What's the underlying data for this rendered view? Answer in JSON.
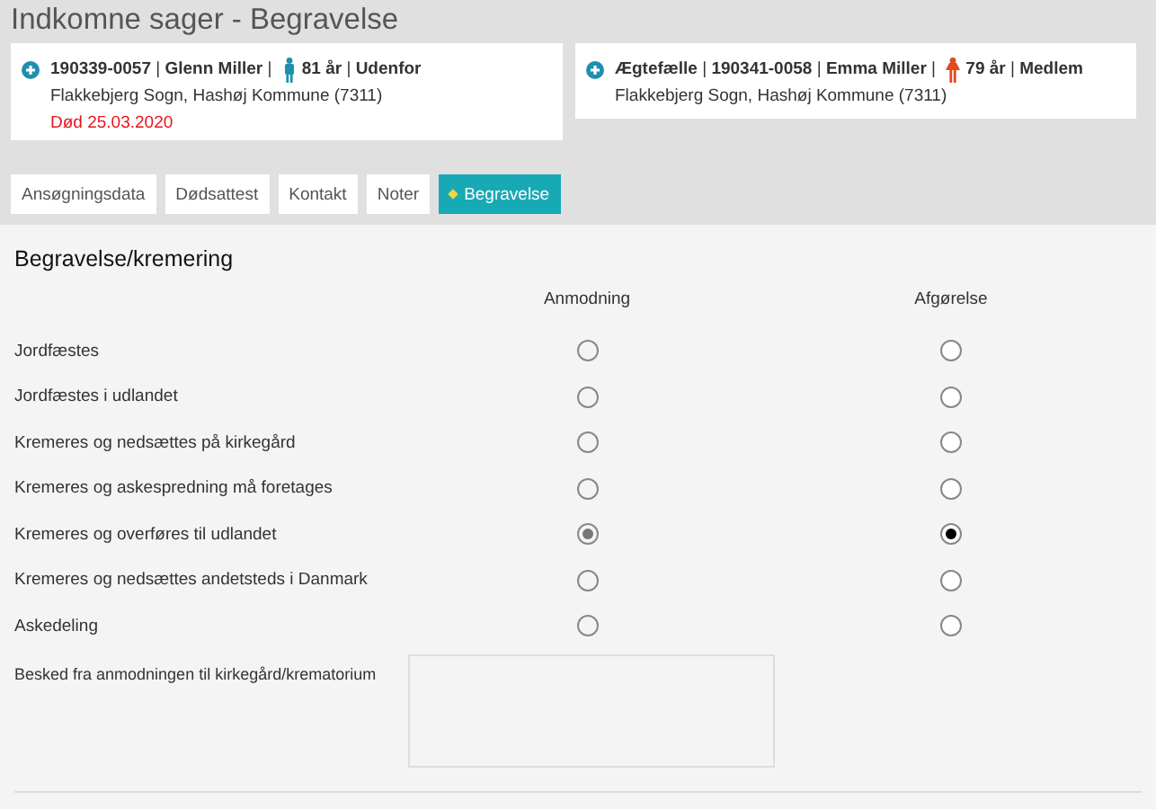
{
  "page_title": "Indkomne sager - Begravelse",
  "persons": [
    {
      "lead": "**190339-0057** | **Glenn Miller** | ",
      "kind": "male",
      "tail": "**81 år** | **Udenfor**",
      "address": "Flakkebjerg Sogn, Hashøj Kommune (7311)",
      "death": "Død 25.03.2020"
    },
    {
      "lead": "**Ægtefælle** | **190341-0058** | **Emma Miller** | ",
      "kind": "female",
      "tail": "**79 år** | **Medlem**",
      "address": "Flakkebjerg Sogn, Hashøj Kommune (7311)"
    }
  ],
  "tabs": [
    {
      "label": "Ansøgningsdata",
      "selected": false
    },
    {
      "label": "Dødsattest",
      "selected": false
    },
    {
      "label": "Kontakt",
      "selected": false
    },
    {
      "label": "Noter",
      "selected": false
    },
    {
      "label": "Begravelse",
      "selected": true
    }
  ],
  "section": {
    "title": "Begravelse/kremering",
    "columns": [
      {
        "label": "Anmodning",
        "disabled": true
      },
      {
        "label": "Afgørelse",
        "disabled": false
      }
    ],
    "rows": [
      {
        "label": "Jordfæstes",
        "choices": [
          {
            "selected": false
          },
          {
            "selected": false
          }
        ]
      },
      {
        "label": "Jordfæstes i udlandet",
        "choices": [
          {
            "selected": false
          },
          {
            "selected": false
          }
        ]
      },
      {
        "label": "Kremeres og nedsættes på kirkegård",
        "choices": [
          {
            "selected": false
          },
          {
            "selected": false
          }
        ]
      },
      {
        "label": "Kremeres og askespredning må foretages",
        "choices": [
          {
            "selected": false
          },
          {
            "selected": false
          }
        ]
      },
      {
        "label": "Kremeres og overføres til udlandet",
        "choices": [
          {
            "selected": true
          },
          {
            "selected": true
          }
        ]
      },
      {
        "label": "Kremeres og nedsættes andetsteds i Danmark",
        "choices": [
          {
            "selected": false
          },
          {
            "selected": false
          }
        ]
      },
      {
        "label": "Askedeling",
        "choices": [
          {
            "selected": false
          },
          {
            "selected": false
          }
        ]
      }
    ],
    "message_label": "Besked fra anmodningen til kirkegård/krematorium"
  }
}
